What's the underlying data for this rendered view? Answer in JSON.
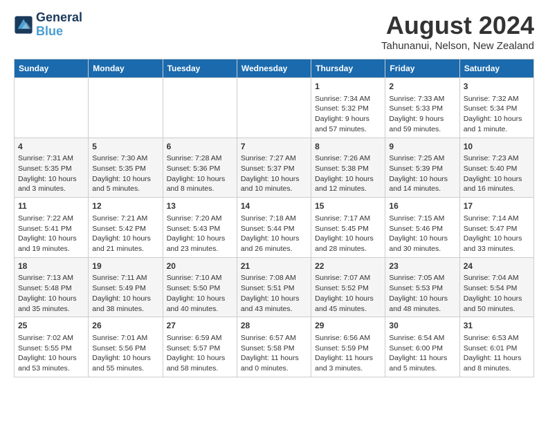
{
  "logo": {
    "line1": "General",
    "line2": "Blue"
  },
  "title": "August 2024",
  "subtitle": "Tahunanui, Nelson, New Zealand",
  "days_of_week": [
    "Sunday",
    "Monday",
    "Tuesday",
    "Wednesday",
    "Thursday",
    "Friday",
    "Saturday"
  ],
  "weeks": [
    [
      {
        "day": "",
        "info": ""
      },
      {
        "day": "",
        "info": ""
      },
      {
        "day": "",
        "info": ""
      },
      {
        "day": "",
        "info": ""
      },
      {
        "day": "1",
        "info": "Sunrise: 7:34 AM\nSunset: 5:32 PM\nDaylight: 9 hours and 57 minutes."
      },
      {
        "day": "2",
        "info": "Sunrise: 7:33 AM\nSunset: 5:33 PM\nDaylight: 9 hours and 59 minutes."
      },
      {
        "day": "3",
        "info": "Sunrise: 7:32 AM\nSunset: 5:34 PM\nDaylight: 10 hours and 1 minute."
      }
    ],
    [
      {
        "day": "4",
        "info": "Sunrise: 7:31 AM\nSunset: 5:35 PM\nDaylight: 10 hours and 3 minutes."
      },
      {
        "day": "5",
        "info": "Sunrise: 7:30 AM\nSunset: 5:35 PM\nDaylight: 10 hours and 5 minutes."
      },
      {
        "day": "6",
        "info": "Sunrise: 7:28 AM\nSunset: 5:36 PM\nDaylight: 10 hours and 8 minutes."
      },
      {
        "day": "7",
        "info": "Sunrise: 7:27 AM\nSunset: 5:37 PM\nDaylight: 10 hours and 10 minutes."
      },
      {
        "day": "8",
        "info": "Sunrise: 7:26 AM\nSunset: 5:38 PM\nDaylight: 10 hours and 12 minutes."
      },
      {
        "day": "9",
        "info": "Sunrise: 7:25 AM\nSunset: 5:39 PM\nDaylight: 10 hours and 14 minutes."
      },
      {
        "day": "10",
        "info": "Sunrise: 7:23 AM\nSunset: 5:40 PM\nDaylight: 10 hours and 16 minutes."
      }
    ],
    [
      {
        "day": "11",
        "info": "Sunrise: 7:22 AM\nSunset: 5:41 PM\nDaylight: 10 hours and 19 minutes."
      },
      {
        "day": "12",
        "info": "Sunrise: 7:21 AM\nSunset: 5:42 PM\nDaylight: 10 hours and 21 minutes."
      },
      {
        "day": "13",
        "info": "Sunrise: 7:20 AM\nSunset: 5:43 PM\nDaylight: 10 hours and 23 minutes."
      },
      {
        "day": "14",
        "info": "Sunrise: 7:18 AM\nSunset: 5:44 PM\nDaylight: 10 hours and 26 minutes."
      },
      {
        "day": "15",
        "info": "Sunrise: 7:17 AM\nSunset: 5:45 PM\nDaylight: 10 hours and 28 minutes."
      },
      {
        "day": "16",
        "info": "Sunrise: 7:15 AM\nSunset: 5:46 PM\nDaylight: 10 hours and 30 minutes."
      },
      {
        "day": "17",
        "info": "Sunrise: 7:14 AM\nSunset: 5:47 PM\nDaylight: 10 hours and 33 minutes."
      }
    ],
    [
      {
        "day": "18",
        "info": "Sunrise: 7:13 AM\nSunset: 5:48 PM\nDaylight: 10 hours and 35 minutes."
      },
      {
        "day": "19",
        "info": "Sunrise: 7:11 AM\nSunset: 5:49 PM\nDaylight: 10 hours and 38 minutes."
      },
      {
        "day": "20",
        "info": "Sunrise: 7:10 AM\nSunset: 5:50 PM\nDaylight: 10 hours and 40 minutes."
      },
      {
        "day": "21",
        "info": "Sunrise: 7:08 AM\nSunset: 5:51 PM\nDaylight: 10 hours and 43 minutes."
      },
      {
        "day": "22",
        "info": "Sunrise: 7:07 AM\nSunset: 5:52 PM\nDaylight: 10 hours and 45 minutes."
      },
      {
        "day": "23",
        "info": "Sunrise: 7:05 AM\nSunset: 5:53 PM\nDaylight: 10 hours and 48 minutes."
      },
      {
        "day": "24",
        "info": "Sunrise: 7:04 AM\nSunset: 5:54 PM\nDaylight: 10 hours and 50 minutes."
      }
    ],
    [
      {
        "day": "25",
        "info": "Sunrise: 7:02 AM\nSunset: 5:55 PM\nDaylight: 10 hours and 53 minutes."
      },
      {
        "day": "26",
        "info": "Sunrise: 7:01 AM\nSunset: 5:56 PM\nDaylight: 10 hours and 55 minutes."
      },
      {
        "day": "27",
        "info": "Sunrise: 6:59 AM\nSunset: 5:57 PM\nDaylight: 10 hours and 58 minutes."
      },
      {
        "day": "28",
        "info": "Sunrise: 6:57 AM\nSunset: 5:58 PM\nDaylight: 11 hours and 0 minutes."
      },
      {
        "day": "29",
        "info": "Sunrise: 6:56 AM\nSunset: 5:59 PM\nDaylight: 11 hours and 3 minutes."
      },
      {
        "day": "30",
        "info": "Sunrise: 6:54 AM\nSunset: 6:00 PM\nDaylight: 11 hours and 5 minutes."
      },
      {
        "day": "31",
        "info": "Sunrise: 6:53 AM\nSunset: 6:01 PM\nDaylight: 11 hours and 8 minutes."
      }
    ]
  ]
}
